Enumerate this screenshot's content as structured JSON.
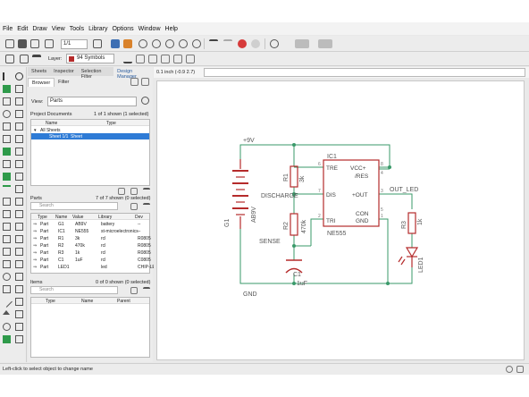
{
  "menu": [
    "File",
    "Edit",
    "Draw",
    "View",
    "Tools",
    "Library",
    "Options",
    "Window",
    "Help"
  ],
  "toolbar": {
    "sheet_select": "1/1",
    "layer_label": "Layer:",
    "layer_value": "94 Symbols",
    "layer_color": "#b52b2b"
  },
  "panel": {
    "tabs": [
      "Sheets",
      "Inspector",
      "Selection Filter",
      "Design Manager"
    ],
    "subtabs": [
      "Browser",
      "Filter"
    ],
    "view_label": "View:",
    "view_value": "Parts",
    "project": {
      "title": "Project Documents",
      "count": "1 of 1 shown (1 selected)",
      "cols": [
        "Name",
        "Type"
      ],
      "rows": [
        [
          "All Sheets",
          ""
        ],
        [
          "Sheet 1/1",
          "Sheet"
        ]
      ]
    },
    "parts": {
      "title": "Parts",
      "count": "7 of 7 shown (0 selected)",
      "search": "Search",
      "cols": [
        "Type",
        "Name",
        "Value",
        "Library",
        "Dev"
      ],
      "rows": [
        [
          "Part",
          "G1",
          "AB9V",
          "battery",
          "--"
        ],
        [
          "Part",
          "IC1",
          "NE555",
          "st-microelectronics",
          "--"
        ],
        [
          "Part",
          "R1",
          "3k",
          "rcl",
          "R0805"
        ],
        [
          "Part",
          "R2",
          "470k",
          "rcl",
          "R0805"
        ],
        [
          "Part",
          "R3",
          "1k",
          "rcl",
          "R0805"
        ],
        [
          "Part",
          "C1",
          "1uF",
          "rcl",
          "C0805"
        ],
        [
          "Part",
          "LED1",
          "",
          "led",
          "CHIP-LE"
        ]
      ]
    },
    "items": {
      "title": "Items",
      "count": "0 of 0 shown (0 selected)",
      "search": "Search",
      "cols": [
        "Type",
        "Name",
        "Parent"
      ]
    }
  },
  "coords": "0.1 inch (-0.9 2.7)",
  "schematic": {
    "labels": {
      "vcc": "+9V",
      "gnd": "GND",
      "discharge": "DISCHARGE",
      "sense": "SENSE",
      "out_led": "OUT_LED",
      "ic": "IC1",
      "ic_value": "NE555",
      "g1": "G1",
      "g1_value": "AB9V",
      "r1": "R1",
      "r1_value": "3k",
      "r2": "R2",
      "r2_value": "470k",
      "r3": "R3",
      "r3_value": "1k",
      "c1": "C1",
      "c1_value": "1uF",
      "led": "LED1"
    },
    "pins": {
      "tre": "TRE",
      "vcc": "VCC+",
      "res": "/RES",
      "dis": "DIS",
      "out": "+OUT",
      "con": "CON",
      "tri": "TRI",
      "gnd": "GND",
      "n8": "8",
      "n4": "4",
      "n7": "7",
      "n3": "3",
      "n6": "6",
      "n5": "5",
      "n2": "2",
      "n1": "1"
    }
  },
  "status": "Left-click to select object to change name",
  "colors": {
    "net": "#3a9a6a",
    "symbol": "#b52b2b",
    "label": "#555555",
    "selection": "#2e7bd6"
  }
}
